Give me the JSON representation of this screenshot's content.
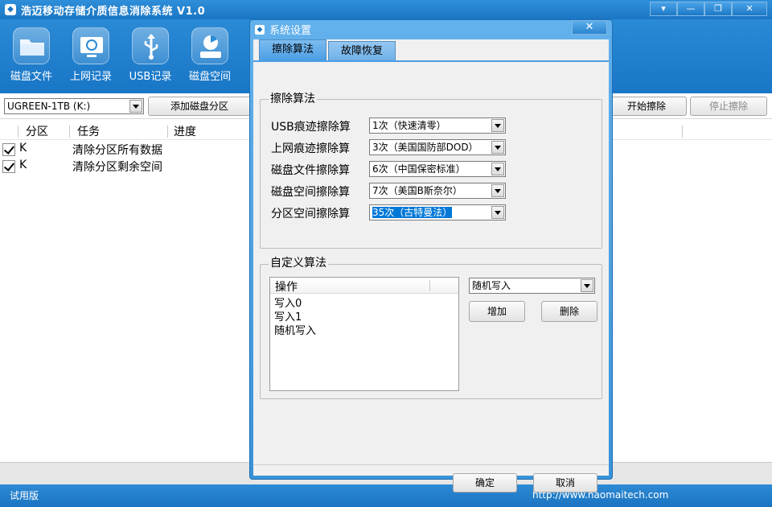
{
  "window": {
    "title": "浩迈移动存储介质信息消除系统 V1.0",
    "controls": [
      "▾",
      "—",
      "❐",
      "✕"
    ]
  },
  "toolbar": {
    "items": [
      {
        "label": "磁盘文件",
        "icon": "folder-icon"
      },
      {
        "label": "上网记录",
        "icon": "browser-history-icon"
      },
      {
        "label": "USB记录",
        "icon": "usb-icon"
      },
      {
        "label": "磁盘空间",
        "icon": "disk-space-icon"
      }
    ]
  },
  "devicebar": {
    "device_selected": "UGREEN-1TB (K:)",
    "add_partition": "添加磁盘分区",
    "start_wipe": "开始擦除",
    "stop_wipe": "停止擦除"
  },
  "task_table": {
    "headers": [
      "分区",
      "任务",
      "进度"
    ],
    "rows": [
      {
        "checked": true,
        "partition": "K",
        "task": "清除分区所有数据"
      },
      {
        "checked": true,
        "partition": "K",
        "task": "清除分区剩余空间"
      }
    ]
  },
  "statusbar": {
    "left": "试用版",
    "url": "http://www.haomaitech.com"
  },
  "dialog": {
    "title": "系统设置",
    "close": "✕",
    "tabs": [
      "擦除算法",
      "故障恢复"
    ],
    "algo_group": {
      "title": "擦除算法",
      "rows": [
        {
          "label": "USB痕迹擦除算",
          "value": "1次（快速清零）"
        },
        {
          "label": "上网痕迹擦除算",
          "value": "3次（美国国防部DOD）"
        },
        {
          "label": "磁盘文件擦除算",
          "value": "6次（中国保密标准）"
        },
        {
          "label": "磁盘空间擦除算",
          "value": "7次（美国B斯奈尔）"
        },
        {
          "label": "分区空间擦除算",
          "value": "35次（古特曼法）"
        }
      ]
    },
    "custom_group": {
      "title": "自定义算法",
      "list_header": "操作",
      "list_items": [
        "写入0",
        "写入1",
        "随机写入"
      ],
      "op_selected": "随机写入",
      "add": "增加",
      "delete": "删除"
    },
    "ok": "确定",
    "cancel": "取消"
  },
  "colors": {
    "titlebar": "#1a76c4",
    "accent": "#0078d7",
    "dialog_frame": "#3a92d7"
  }
}
